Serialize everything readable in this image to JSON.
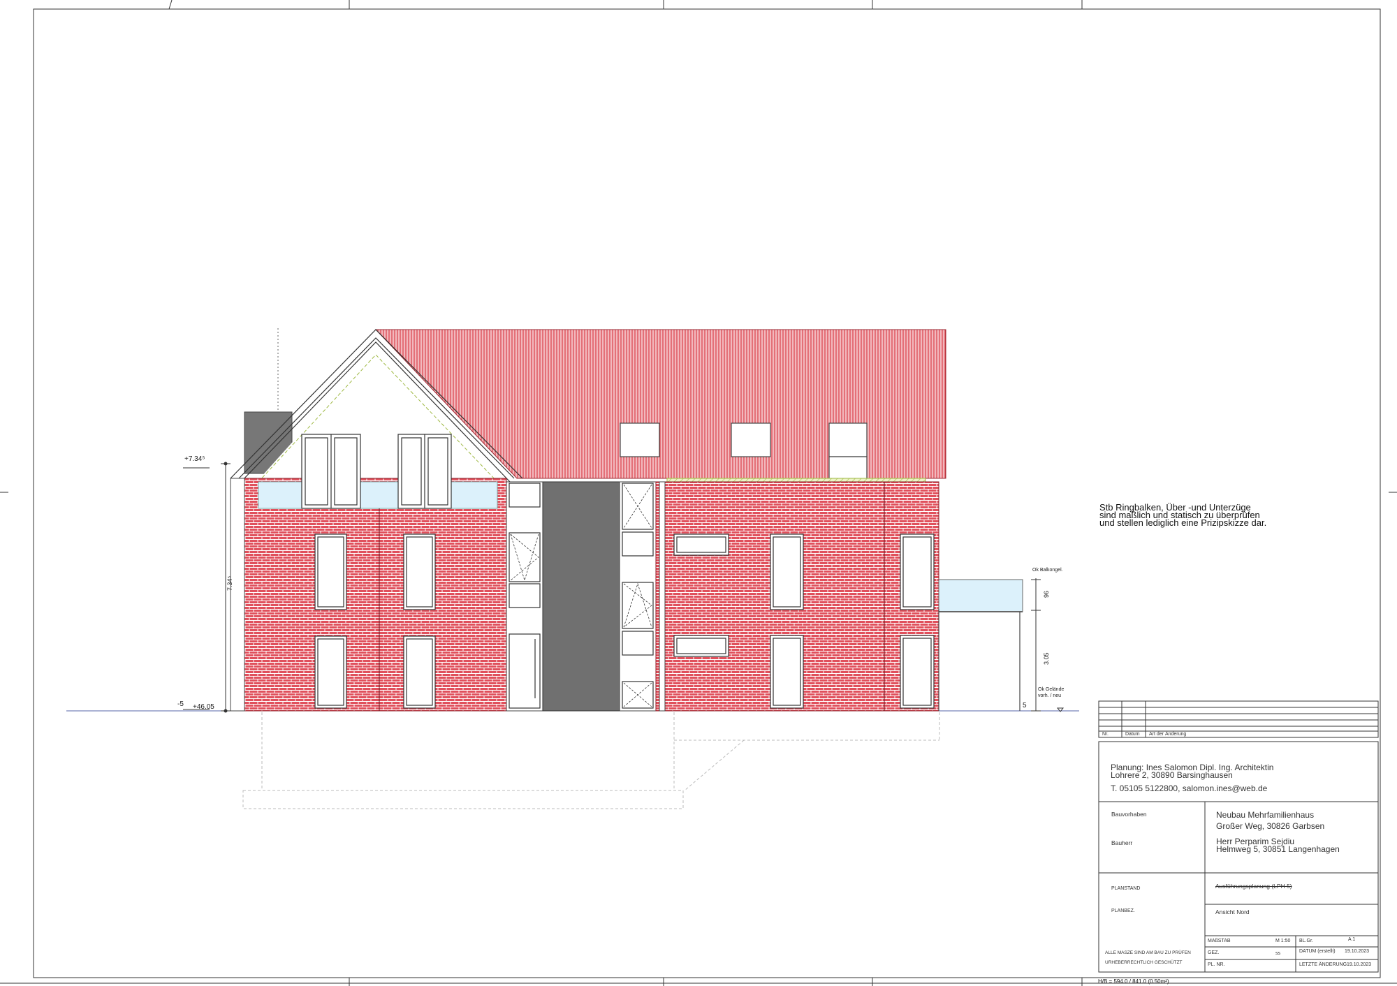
{
  "elevation": {
    "level_top": "+7.34⁵",
    "level_ground": "+46.05",
    "left_offset": "-5",
    "height_dim": "7.34⁵",
    "label_balcony": "Ok Balkongel.",
    "dim_balcony": "96",
    "dim_lower": "3.05",
    "label_terrain_1": "Ok Gelände",
    "label_terrain_2": "vorh. / neu",
    "right_offset": "5"
  },
  "note": {
    "lines": [
      "Stb Ringbalken, Über -und Unterzüge",
      "sind maßlich und statisch zu überprüfen",
      "und stellen lediglich eine Prizipskizze dar."
    ]
  },
  "revision_table": {
    "col_nr": "Nr.",
    "col_date": "Datum",
    "col_change": "Art der Änderung"
  },
  "title_block": {
    "planning_line1": "Planung: Ines Salomon Dipl. Ing. Architektin",
    "planning_line2": "Lohrere 2, 30890  Barsinghausen",
    "contact": "T. 05105 5122800, salomon.ines@web.de",
    "project_label": "Bauvorhaben",
    "project_line1": "Neubau Mehrfamilienhaus",
    "project_line2": "Großer Weg, 30826 Garbsen",
    "client_label": "Bauherr",
    "client_line1": "Herr Perparim Sejdiu",
    "client_line2": "Helmweg 5, 30851 Langenhagen",
    "status_label": "PLANSTAND",
    "status_value": "Ausführungsplanung (LPH 5)",
    "plan_label": "PLANBEZ.",
    "plan_value": "Ansicht Nord",
    "notice1": "ALLE MASZE SIND AM BAU ZU PRÜFEN",
    "notice2": "URHEBERRECHTLICH GESCHÜTZT",
    "scale_label": "MAßSTAB",
    "scale_value": "M 1:50",
    "sheet_label": "BL.Gr.",
    "sheet_value": "A 1",
    "drawn_label": "GEZ.",
    "drawn_value": "ss",
    "date_label": "DATUM (erstellt)",
    "date_value": "19.10.2023",
    "plan_nr_label": "PL. NR.",
    "last_change_label": "LETZTE ÄNDERUNG",
    "last_change_value": "19.10.2023"
  },
  "footer": {
    "format": "H/B = 594.0 / 841.0 (0.50m²)"
  }
}
